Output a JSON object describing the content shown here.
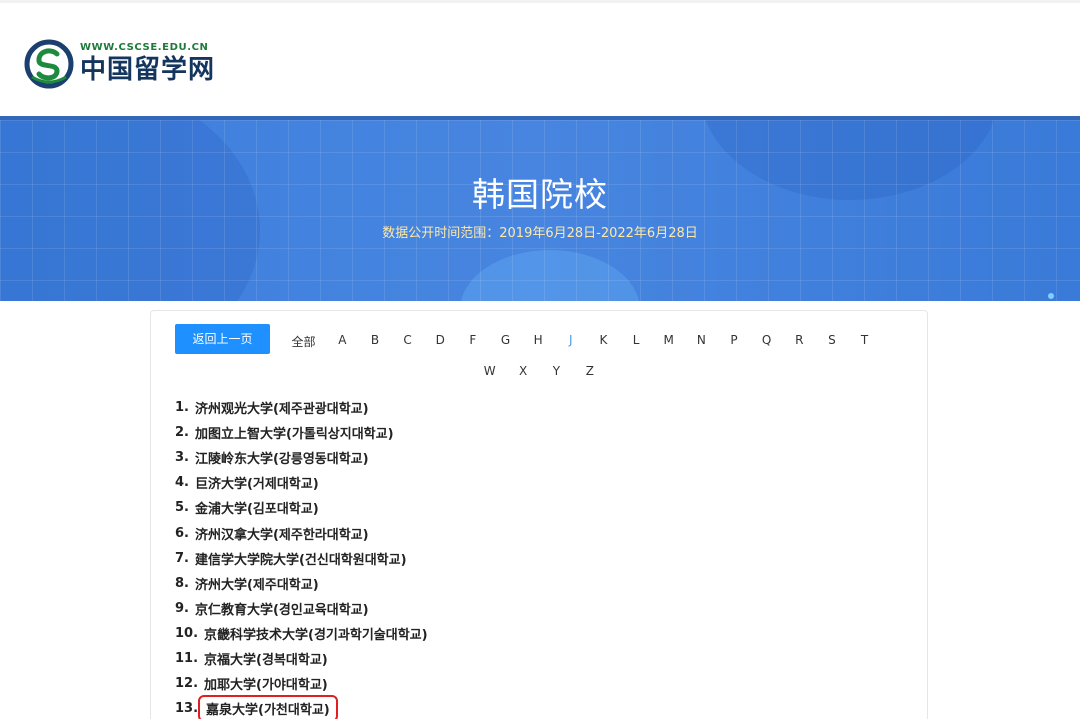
{
  "header": {
    "logo_url_text": "WWW.CSCSE.EDU.CN",
    "logo_name": "中国留学网"
  },
  "banner": {
    "title": "韩国院校",
    "subtitle": "数据公开时间范围：2019年6月28日-2022年6月28日"
  },
  "nav": {
    "back_label": "返回上一页",
    "letters_row1": [
      "全部",
      "A",
      "B",
      "C",
      "D",
      "F",
      "G",
      "H",
      "J",
      "K",
      "L",
      "M",
      "N",
      "P",
      "Q",
      "R",
      "S",
      "T"
    ],
    "letters_row2": [
      "W",
      "X",
      "Y",
      "Z"
    ],
    "active_letter": "J"
  },
  "schools": [
    {
      "num": "1.",
      "name": "济州观光大学(제주관광대학교)"
    },
    {
      "num": "2.",
      "name": "加图立上智大学(가톨릭상지대학교)"
    },
    {
      "num": "3.",
      "name": "江陵岭东大学(강릉영동대학교)"
    },
    {
      "num": "4.",
      "name": "巨济大学(거제대학교)"
    },
    {
      "num": "5.",
      "name": "金浦大学(김포대학교)"
    },
    {
      "num": "6.",
      "name": "济州汉拿大学(제주한라대학교)"
    },
    {
      "num": "7.",
      "name": "建信学大学院大学(건신대학원대학교)"
    },
    {
      "num": "8.",
      "name": "济州大学(제주대학교)"
    },
    {
      "num": "9.",
      "name": "京仁教育大学(경인교육대학교)"
    },
    {
      "num": "10.",
      "name": "京畿科学技术大学(경기과학기술대학교)"
    },
    {
      "num": "11.",
      "name": "京福大学(경복대학교)"
    },
    {
      "num": "12.",
      "name": "加耶大学(가야대학교)"
    },
    {
      "num": "13.",
      "name": "嘉泉大学(가천대학교)"
    }
  ],
  "highlighted_index": 12,
  "colors": {
    "accent": "#1e90ff",
    "banner": "#4785e0",
    "highlight_border": "#e02020",
    "active_letter": "#4a9be8"
  }
}
